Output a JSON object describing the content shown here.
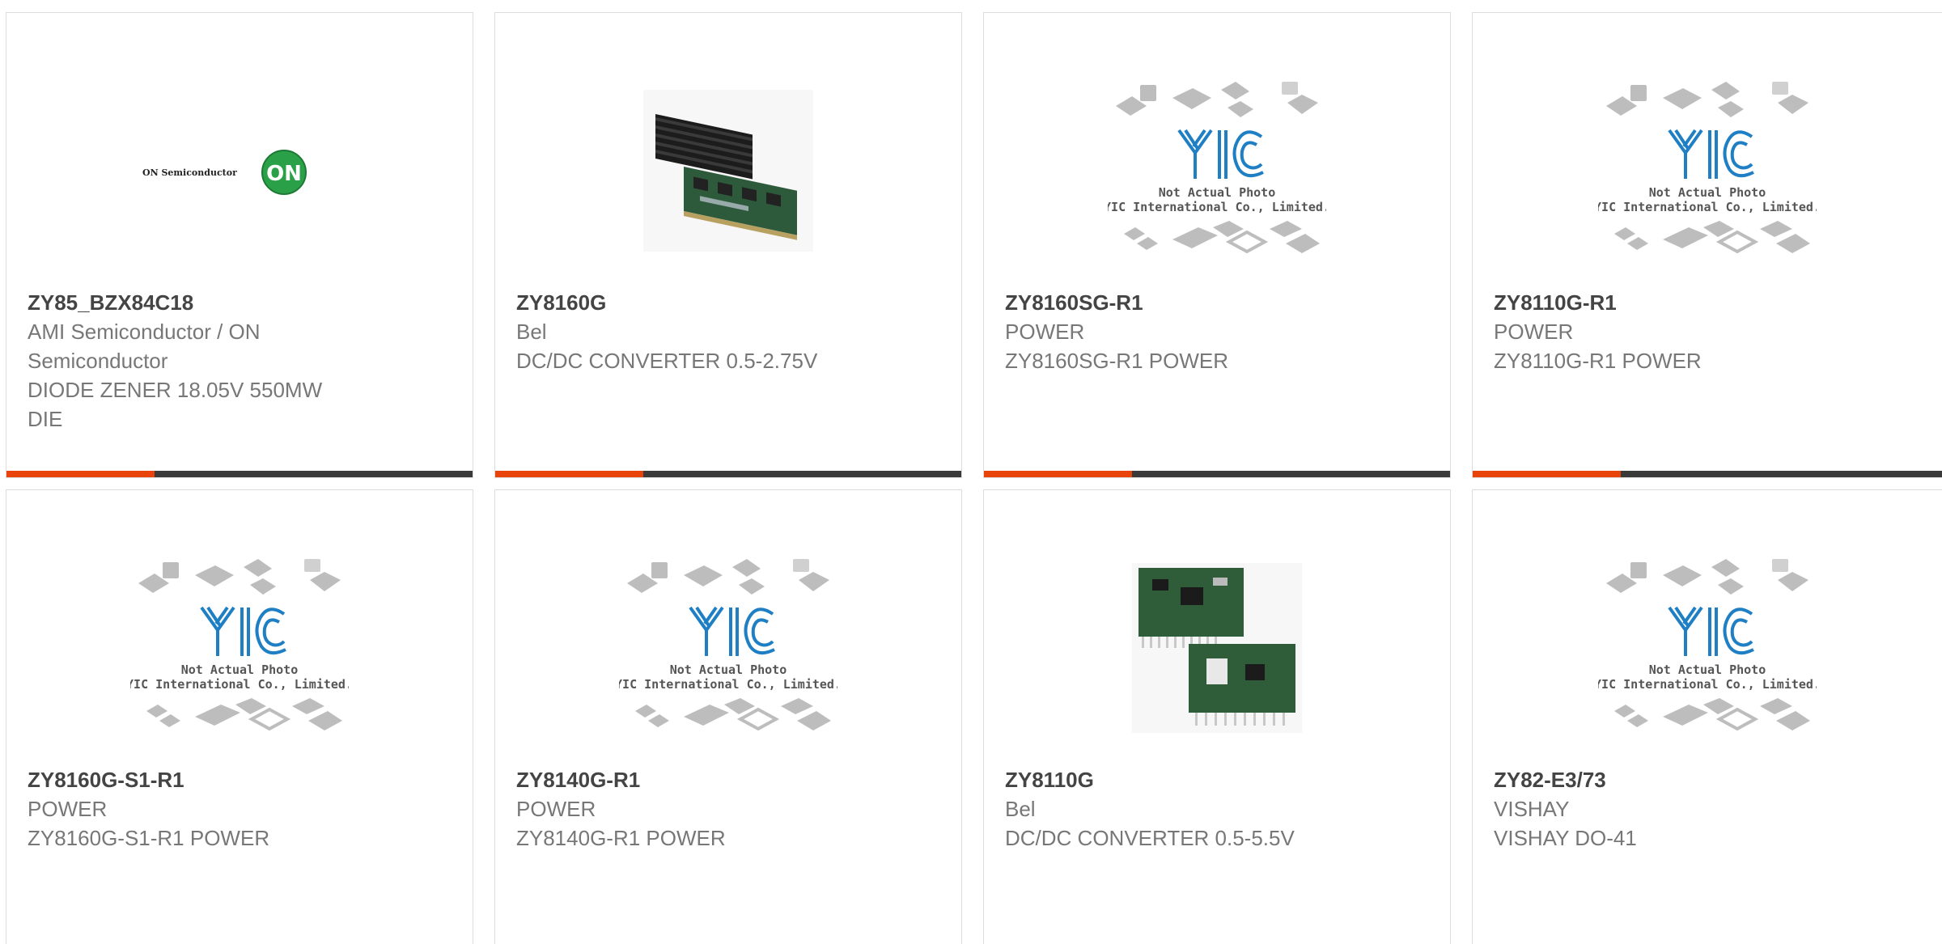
{
  "colors": {
    "accent": "#e8430a",
    "bar": "#3a3a3a",
    "yic_blue": "#1e7fc4",
    "on_green": "#2aa148"
  },
  "placeholder": {
    "logo": "YIC",
    "line1": "Not Actual Photo",
    "line2": "YIC International Co., Limited."
  },
  "on_logo": {
    "wordmark": "ON Semiconductor",
    "badge": "ON"
  },
  "products": [
    {
      "part": "ZY85_BZX84C18",
      "image": "on-semiconductor-logo",
      "lines": [
        "AMI Semiconductor / ON",
        "Semiconductor",
        "DIODE ZENER 18.05V 550MW",
        "DIE"
      ]
    },
    {
      "part": "ZY8160G",
      "image": "dc-dc-module-photo",
      "lines": [
        "Bel",
        "DC/DC CONVERTER 0.5-2.75V"
      ]
    },
    {
      "part": "ZY8160SG-R1",
      "image": "yic-placeholder",
      "lines": [
        "POWER",
        "ZY8160SG-R1 POWER"
      ]
    },
    {
      "part": "ZY8110G-R1",
      "image": "yic-placeholder",
      "lines": [
        "POWER",
        "ZY8110G-R1 POWER"
      ]
    },
    {
      "part": "ZY8160G-S1-R1",
      "image": "yic-placeholder",
      "lines": [
        "POWER",
        "ZY8160G-S1-R1 POWER"
      ]
    },
    {
      "part": "ZY8140G-R1",
      "image": "yic-placeholder",
      "lines": [
        "POWER",
        "ZY8140G-R1 POWER"
      ]
    },
    {
      "part": "ZY8110G",
      "image": "pcb-module-photo",
      "lines": [
        "Bel",
        "DC/DC CONVERTER 0.5-5.5V"
      ]
    },
    {
      "part": "ZY82-E3/73",
      "image": "yic-placeholder",
      "lines": [
        "VISHAY",
        "VISHAY DO-41"
      ]
    }
  ]
}
